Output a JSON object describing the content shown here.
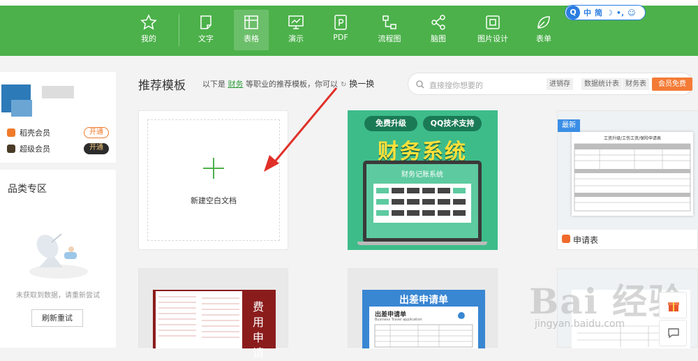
{
  "nav": {
    "items": [
      {
        "label": "我的",
        "icon": "star-icon"
      },
      {
        "label": "文字",
        "icon": "document-icon"
      },
      {
        "label": "表格",
        "icon": "table-icon",
        "active": true
      },
      {
        "label": "演示",
        "icon": "presentation-icon"
      },
      {
        "label": "PDF",
        "icon": "pdf-icon"
      },
      {
        "label": "流程图",
        "icon": "flowchart-icon"
      },
      {
        "label": "脑图",
        "icon": "mindmap-icon"
      },
      {
        "label": "图片设计",
        "icon": "image-design-icon"
      },
      {
        "label": "表单",
        "icon": "form-icon"
      }
    ],
    "accent": "#4cb14a"
  },
  "ime": {
    "logo": "Q",
    "mode": "中",
    "width_mode": "简"
  },
  "user": {
    "vip1_label": "稻壳会员",
    "vip1_action": "开通",
    "vip2_label": "超级会员",
    "vip2_action": "开通"
  },
  "category": {
    "title": "品类专区",
    "empty_text": "未获取到数据，请重新尝试",
    "refresh_label": "刷新重试"
  },
  "main": {
    "title": "推荐模板",
    "desc_prefix": "以下是",
    "desc_profession": "财务",
    "desc_suffix": "等职业的推荐模板，你可以",
    "swap_label": "换一换"
  },
  "search": {
    "placeholder": "直接搜你想要的",
    "tags": [
      "进销存",
      "数据统计表",
      "财务表"
    ],
    "vip_free_label": "会员免费"
  },
  "templates": {
    "new_doc_label": "新建空白文档",
    "finance_pill1": "免费升级",
    "finance_pill2": "QQ技术支持",
    "finance_title": "财务系统",
    "finance_screen_title": "财务记账系统",
    "form_latest": "最新",
    "form_sheet_title": "工资升级/工伤工资/保险申请表",
    "form_name": "申请表",
    "maroon_title": "费用申请",
    "blue_title": "出差申请单",
    "blue_sheet_title": "出差申请单",
    "blue_sheet_sub": "Business Travel application"
  },
  "watermark": {
    "logo": "Bai 经验",
    "url": "jingyan.baidu.com"
  }
}
